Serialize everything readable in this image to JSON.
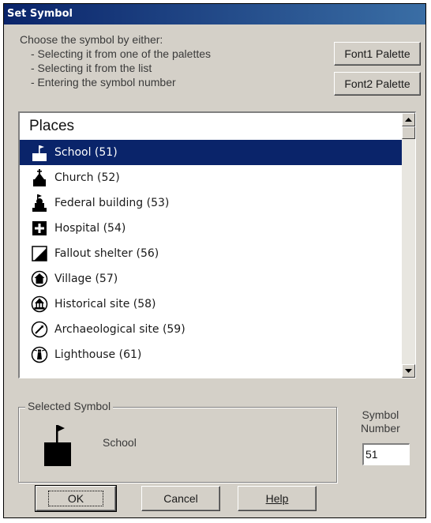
{
  "window": {
    "title": "Set Symbol"
  },
  "instructions": {
    "heading": "Choose the symbol by either:",
    "options": [
      "- Selecting it from one of the palettes",
      "- Selecting it from the list",
      "- Entering the symbol number"
    ]
  },
  "palette_buttons": {
    "font1": "Font1 Palette",
    "font2": "Font2 Palette"
  },
  "list": {
    "header": "Places",
    "items": [
      {
        "label": "School (51)",
        "icon": "school-icon",
        "selected": true
      },
      {
        "label": "Church (52)",
        "icon": "church-icon",
        "selected": false
      },
      {
        "label": "Federal building (53)",
        "icon": "federal-building-icon",
        "selected": false
      },
      {
        "label": "Hospital (54)",
        "icon": "hospital-icon",
        "selected": false
      },
      {
        "label": "Fallout shelter (56)",
        "icon": "fallout-shelter-icon",
        "selected": false
      },
      {
        "label": "Village (57)",
        "icon": "village-icon",
        "selected": false
      },
      {
        "label": "Historical site (58)",
        "icon": "historical-site-icon",
        "selected": false
      },
      {
        "label": "Archaeological site (59)",
        "icon": "archaeological-site-icon",
        "selected": false
      },
      {
        "label": "Lighthouse (61)",
        "icon": "lighthouse-icon",
        "selected": false
      }
    ]
  },
  "selected_symbol": {
    "group_label": "Selected Symbol",
    "name": "School",
    "icon": "school-icon"
  },
  "symbol_number": {
    "label_line1": "Symbol",
    "label_line2": "Number",
    "value": "51"
  },
  "buttons": {
    "ok": "OK",
    "cancel": "Cancel",
    "help": "Help"
  },
  "colors": {
    "title_bar": "#0a246a",
    "selection": "#0a246a",
    "dialog_face": "#d4d0c8"
  }
}
